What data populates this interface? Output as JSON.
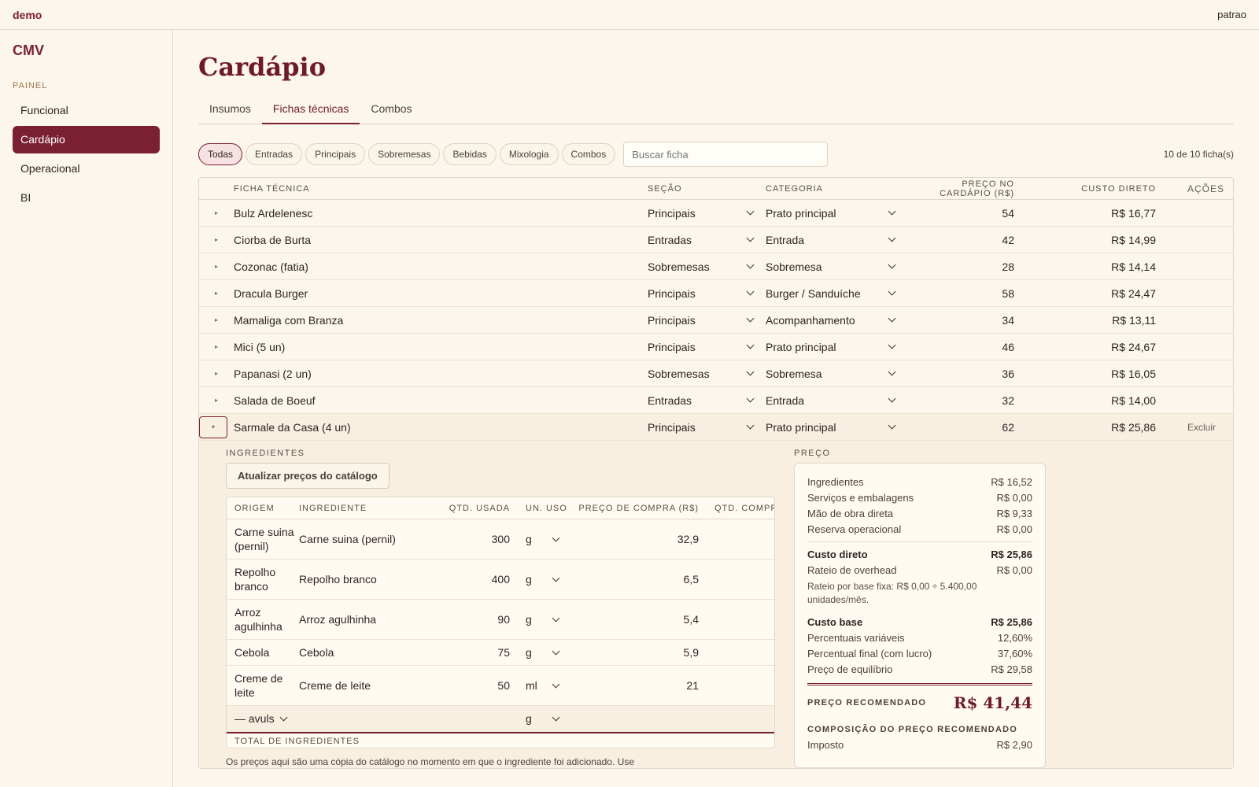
{
  "topbar": {
    "brand": "demo",
    "user": "patrao"
  },
  "sidebar": {
    "title": "CMV",
    "section": "PAINEL",
    "items": [
      {
        "label": "Funcional"
      },
      {
        "label": "Cardápio"
      },
      {
        "label": "Operacional"
      },
      {
        "label": "BI"
      }
    ]
  },
  "page": {
    "title": "Cardápio"
  },
  "tabs": [
    {
      "label": "Insumos"
    },
    {
      "label": "Fichas técnicas"
    },
    {
      "label": "Combos"
    }
  ],
  "filters": {
    "chips": [
      "Todas",
      "Entradas",
      "Principais",
      "Sobremesas",
      "Bebidas",
      "Mixologia",
      "Combos"
    ],
    "search_placeholder": "Buscar ficha",
    "count": "10 de 10 ficha(s)"
  },
  "table": {
    "headers": {
      "name": "FICHA TÉCNICA",
      "section": "SEÇÃO",
      "category": "CATEGORIA",
      "price": "PREÇO NO CARDÁPIO (R$)",
      "cost": "CUSTO DIRETO",
      "actions": "AÇÕES"
    },
    "rows": [
      {
        "name": "Bulz Ardelenesc",
        "section": "Principais",
        "category": "Prato principal",
        "price": "54",
        "cost": "R$ 16,77"
      },
      {
        "name": "Ciorba de Burta",
        "section": "Entradas",
        "category": "Entrada",
        "price": "42",
        "cost": "R$ 14,99"
      },
      {
        "name": "Cozonac (fatia)",
        "section": "Sobremesas",
        "category": "Sobremesa",
        "price": "28",
        "cost": "R$ 14,14"
      },
      {
        "name": "Dracula Burger",
        "section": "Principais",
        "category": "Burger / Sanduíche",
        "price": "58",
        "cost": "R$ 24,47"
      },
      {
        "name": "Mamaliga com Branza",
        "section": "Principais",
        "category": "Acompanhamento",
        "price": "34",
        "cost": "R$ 13,11"
      },
      {
        "name": "Mici (5 un)",
        "section": "Principais",
        "category": "Prato principal",
        "price": "46",
        "cost": "R$ 24,67"
      },
      {
        "name": "Papanasi (2 un)",
        "section": "Sobremesas",
        "category": "Sobremesa",
        "price": "36",
        "cost": "R$ 16,05"
      },
      {
        "name": "Salada de Boeuf",
        "section": "Entradas",
        "category": "Entrada",
        "price": "32",
        "cost": "R$ 14,00"
      },
      {
        "name": "Sarmale da Casa (4 un)",
        "section": "Principais",
        "category": "Prato principal",
        "price": "62",
        "cost": "R$ 25,86",
        "action": "Excluir"
      }
    ]
  },
  "ingredients": {
    "label": "INGREDIENTES",
    "update_button": "Atualizar preços do catálogo",
    "headers": {
      "origin": "ORIGEM",
      "ingredient": "INGREDIENTE",
      "qty": "QTD. USADA",
      "unit": "UN. USO",
      "buy_price": "PREÇO DE COMPRA (R$)",
      "qty_buy": "QTD. COMPR"
    },
    "rows": [
      {
        "origin": "Carne suina (pernil)",
        "ingredient": "Carne suina (pernil)",
        "qty": "300",
        "unit": "g",
        "buy_price": "32,9"
      },
      {
        "origin": "Repolho branco",
        "ingredient": "Repolho branco",
        "qty": "400",
        "unit": "g",
        "buy_price": "6,5"
      },
      {
        "origin": "Arroz agulhinha",
        "ingredient": "Arroz agulhinha",
        "qty": "90",
        "unit": "g",
        "buy_price": "5,4"
      },
      {
        "origin": "Cebola",
        "ingredient": "Cebola",
        "qty": "75",
        "unit": "g",
        "buy_price": "5,9"
      },
      {
        "origin": "Creme de leite",
        "ingredient": "Creme de leite",
        "qty": "50",
        "unit": "ml",
        "buy_price": "21"
      }
    ],
    "new_row": {
      "origin": "— avuls",
      "unit": "g"
    },
    "total_label": "TOTAL DE INGREDIENTES",
    "note": "Os preços aqui são uma cópia do catálogo no momento em que o ingrediente foi adicionado. Use"
  },
  "pricing": {
    "label": "PREÇO",
    "lines_a": [
      {
        "label": "Ingredientes",
        "value": "R$ 16,52"
      },
      {
        "label": "Serviços e embalagens",
        "value": "R$ 0,00"
      },
      {
        "label": "Mão de obra direta",
        "value": "R$ 9,33"
      },
      {
        "label": "Reserva operacional",
        "value": "R$ 0,00"
      }
    ],
    "direct_cost": {
      "label": "Custo direto",
      "value": "R$ 25,86"
    },
    "overhead": {
      "label": "Rateio de overhead",
      "value": "R$ 0,00"
    },
    "overhead_note": "Rateio por base fixa: R$ 0,00 ÷ 5.400,00 unidades/mês.",
    "base_cost": {
      "label": "Custo base",
      "value": "R$ 25,86"
    },
    "lines_b": [
      {
        "label": "Percentuais variáveis",
        "value": "12,60%"
      },
      {
        "label": "Percentual final (com lucro)",
        "value": "37,60%"
      },
      {
        "label": "Preço de equilíbrio",
        "value": "R$ 29,58"
      }
    ],
    "recommended": {
      "label": "PREÇO RECOMENDADO",
      "value": "R$ 41,44"
    },
    "composition_label": "COMPOSIÇÃO DO PREÇO RECOMENDADO",
    "composition": [
      {
        "label": "Imposto",
        "value": "R$ 2,90"
      }
    ]
  }
}
